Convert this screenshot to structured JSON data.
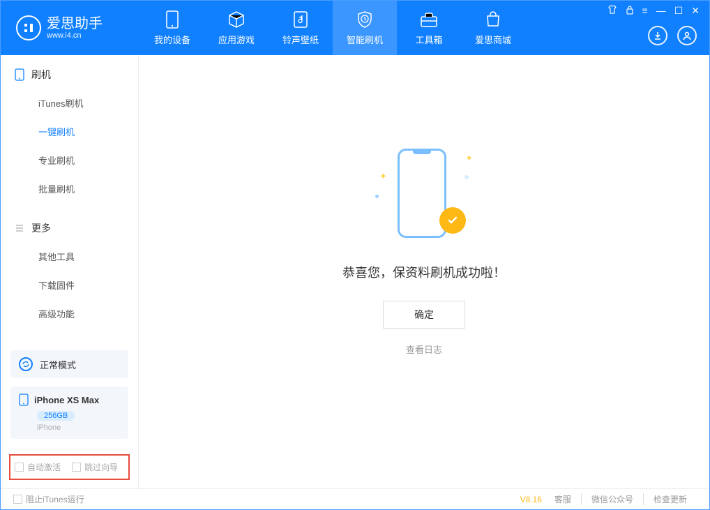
{
  "app": {
    "title": "爱思助手",
    "subtitle": "www.i4.cn"
  },
  "nav": {
    "items": [
      {
        "label": "我的设备"
      },
      {
        "label": "应用游戏"
      },
      {
        "label": "铃声壁纸"
      },
      {
        "label": "智能刷机"
      },
      {
        "label": "工具箱"
      },
      {
        "label": "爱思商城"
      }
    ]
  },
  "sidebar": {
    "section1_title": "刷机",
    "section1_items": [
      "iTunes刷机",
      "一键刷机",
      "专业刷机",
      "批量刷机"
    ],
    "section2_title": "更多",
    "section2_items": [
      "其他工具",
      "下载固件",
      "高级功能"
    ]
  },
  "mode": {
    "label": "正常模式"
  },
  "device": {
    "name": "iPhone XS Max",
    "storage": "256GB",
    "type": "iPhone"
  },
  "checkboxes": {
    "auto_activate": "自动激活",
    "skip_guide": "跳过向导"
  },
  "main": {
    "success_text": "恭喜您，保资料刷机成功啦！",
    "ok_label": "确定",
    "view_log": "查看日志"
  },
  "footer": {
    "block_itunes": "阻止iTunes运行",
    "version": "V8.16",
    "links": [
      "客服",
      "微信公众号",
      "检查更新"
    ]
  }
}
